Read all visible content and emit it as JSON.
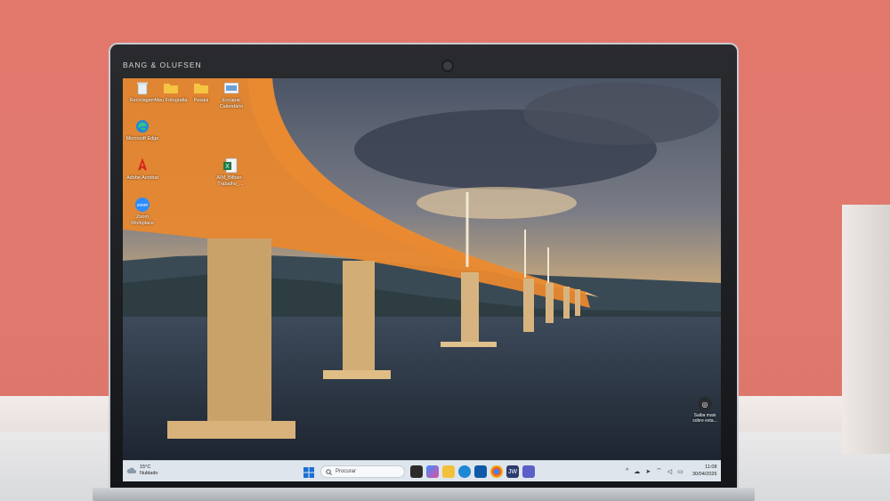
{
  "laptop": {
    "brand": "BANG & OLUFSEN"
  },
  "desktop_icons": [
    {
      "label": "Reciclagem",
      "icon": "recycle-bin-icon"
    },
    {
      "label": "Meu Fotografia",
      "icon": "folder-icon"
    },
    {
      "label": "Pesqui",
      "icon": "folder-icon"
    },
    {
      "label": "Encapar Calendário",
      "icon": "image-file-icon"
    },
    {
      "label": "Microsoft Edge",
      "icon": "edge-icon"
    },
    {
      "label": "Adobe Acrobat",
      "icon": "acrobat-icon"
    },
    {
      "label": "Zoom Workplace",
      "icon": "zoom-icon"
    },
    {
      "label": "AIM_Bilbao - Trabalho_...",
      "icon": "excel-icon"
    }
  ],
  "widget": {
    "label": "Saiba mais sobre esta..."
  },
  "taskbar": {
    "weather_temp": "15°C",
    "weather_desc": "Nublado",
    "search_placeholder": "Procurar",
    "apps": [
      "task-view-icon",
      "copilot-icon",
      "file-explorer-icon",
      "edge-icon",
      "store-icon",
      "chrome-icon",
      "jw-icon",
      "teams-icon"
    ],
    "jw_label": "JW",
    "tray_chevron": "^",
    "clock_time": "11:08",
    "clock_date": "30/04/2026"
  },
  "colors": {
    "taskbar_bg": "#dfe5ec",
    "edge_blue": "#1e88d6",
    "zoom_blue": "#2d8cff",
    "acrobat_red": "#d8261c",
    "excel_green": "#1e7a44"
  }
}
